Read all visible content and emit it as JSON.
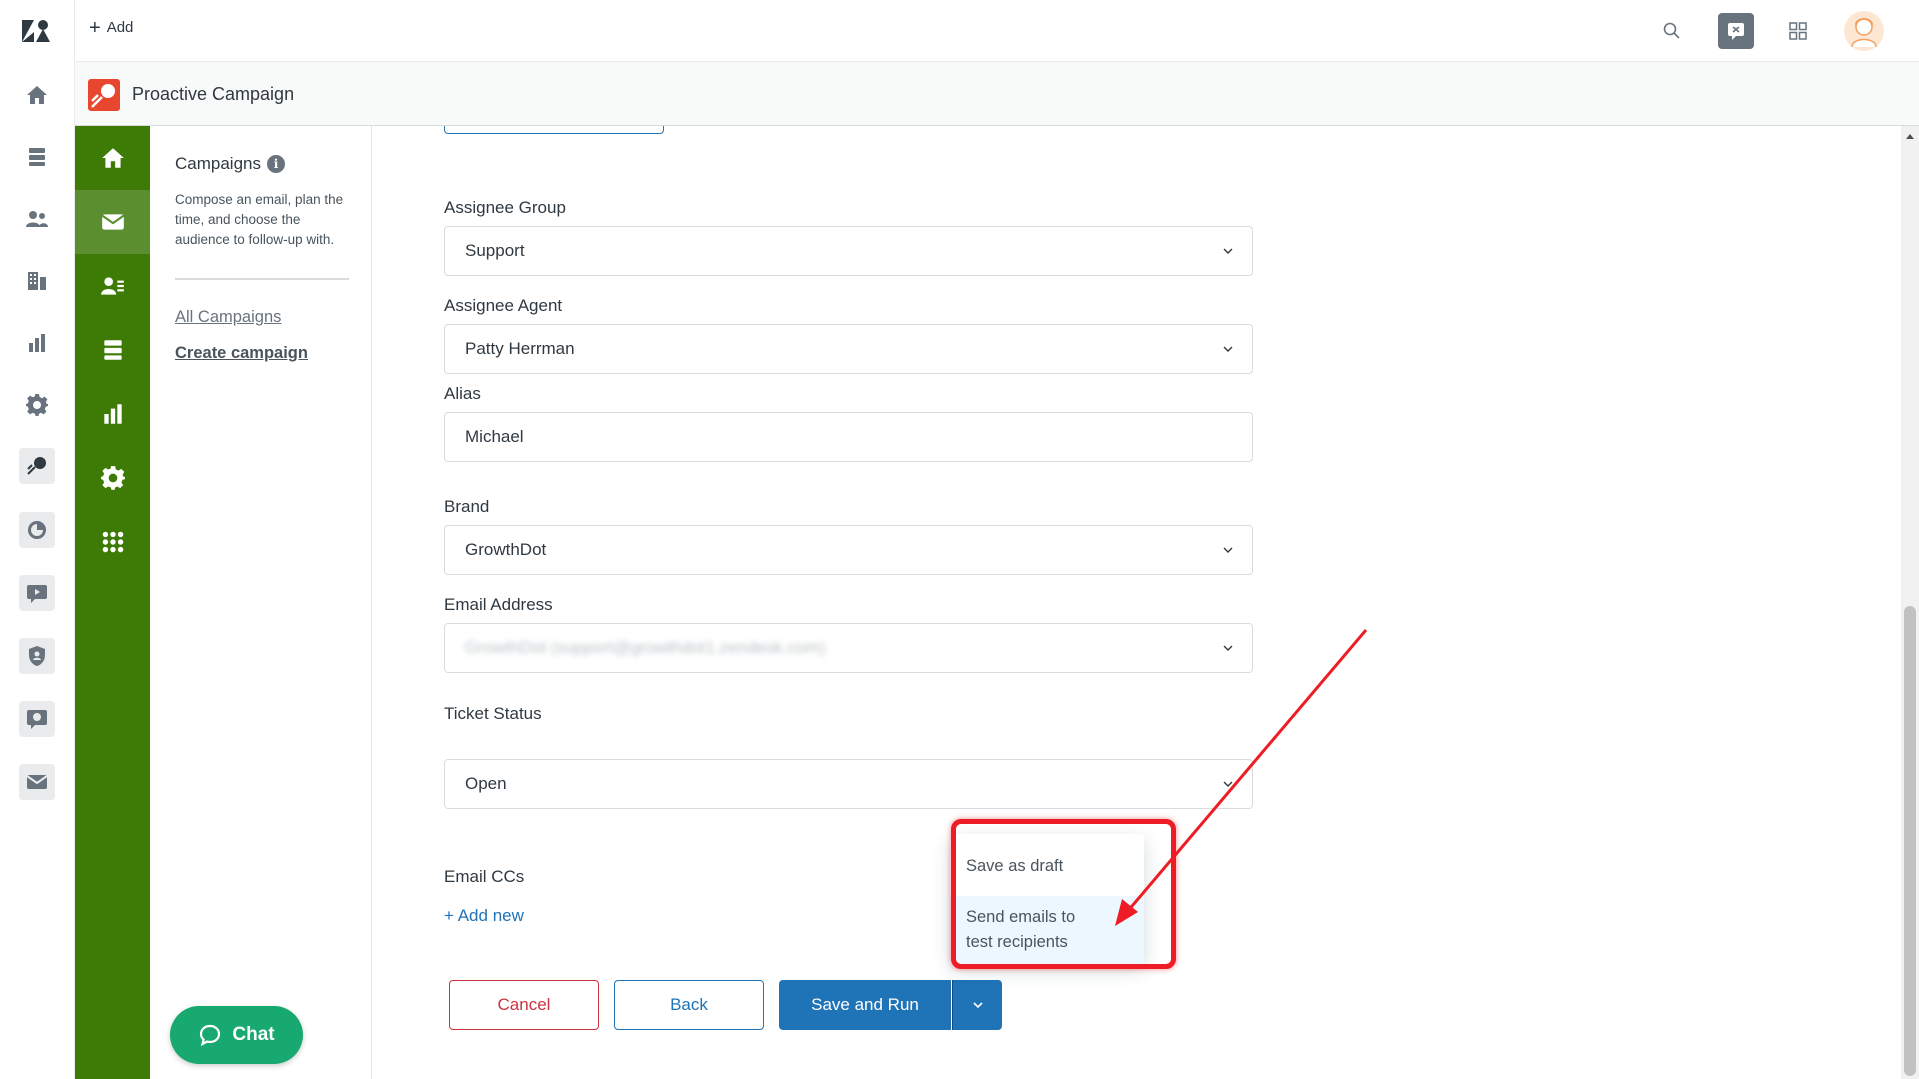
{
  "topbar": {
    "add_label": "Add"
  },
  "app": {
    "title": "Proactive Campaign"
  },
  "sidebar": {
    "heading": "Campaigns",
    "info_glyph": "i",
    "description": "Compose an email, plan the time, and choose the audience to follow-up with.",
    "links": [
      {
        "label": "All Campaigns"
      },
      {
        "label": "Create campaign"
      }
    ]
  },
  "form": {
    "assignee_group": {
      "label": "Assignee Group",
      "value": "Support"
    },
    "assignee_agent": {
      "label": "Assignee Agent",
      "value": "Patty Herrman"
    },
    "alias": {
      "label": "Alias",
      "value": "Michael"
    },
    "brand": {
      "label": "Brand",
      "value": "GrowthDot"
    },
    "email_address": {
      "label": "Email Address",
      "value": "GrowthDot (support@growthdot1.zendesk.com)"
    },
    "ticket_status": {
      "label": "Ticket Status",
      "value": "Open"
    },
    "email_ccs": {
      "label": "Email CCs",
      "add_new": "Add new"
    }
  },
  "actions": {
    "cancel": "Cancel",
    "back": "Back",
    "save_run": "Save and Run"
  },
  "dropdown": {
    "items": [
      {
        "label": "Save as draft"
      },
      {
        "label": "Send emails to test recipients"
      }
    ]
  },
  "chat": {
    "label": "Chat"
  },
  "colors": {
    "brand_green": "#3d7a06",
    "primary_blue": "#1f73b7",
    "danger_red": "#cc3340",
    "annotation_red": "#ee1c24",
    "chat_green": "#17a96f"
  }
}
